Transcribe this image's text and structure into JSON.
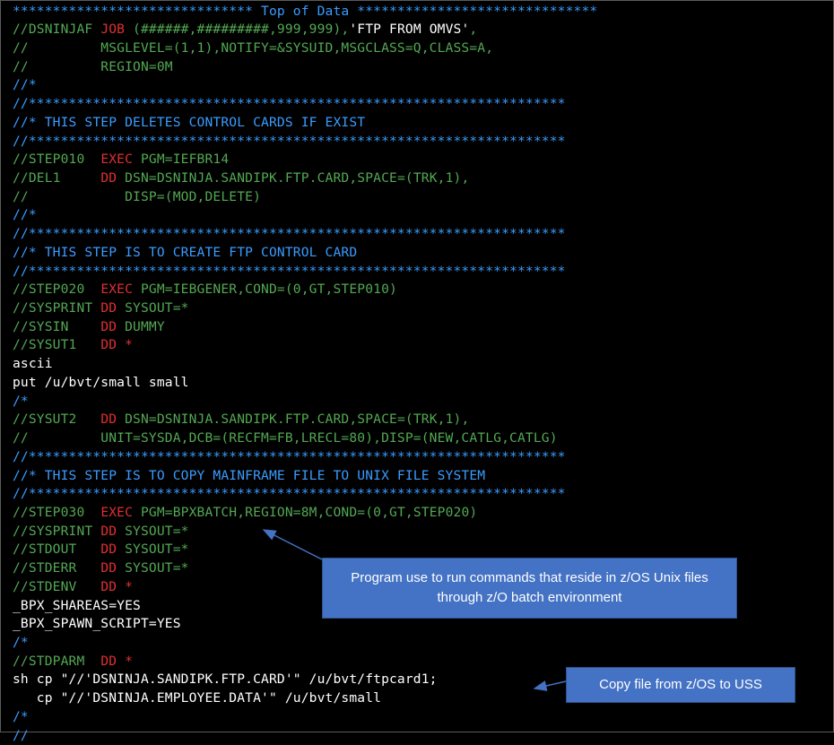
{
  "colors": {
    "background": "#000000",
    "green": "#53a853",
    "red": "#e03030",
    "white": "#ffffff",
    "blue": "#3a9cff",
    "callout_fill": "#4472c4",
    "arrow": "#4472c4"
  },
  "lines": [
    [
      {
        "t": "****************************** Top of Data ******************************",
        "c": "blue"
      }
    ],
    [
      {
        "t": "//DSNINJAF ",
        "c": "green"
      },
      {
        "t": "JOB",
        "c": "red"
      },
      {
        "t": " (######,#########,999,999),",
        "c": "green"
      },
      {
        "t": "'FTP FROM OMVS'",
        "c": "white"
      },
      {
        "t": ",",
        "c": "green"
      }
    ],
    [
      {
        "t": "//         MSGLEVEL=(1,1),NOTIFY=&SYSUID,MSGCLASS=Q,CLASS=A,",
        "c": "green"
      }
    ],
    [
      {
        "t": "//         REGION=0M",
        "c": "green"
      }
    ],
    [
      {
        "t": "//*",
        "c": "blue"
      }
    ],
    [
      {
        "t": "//*******************************************************************",
        "c": "blue"
      }
    ],
    [
      {
        "t": "//* THIS STEP DELETES CONTROL CARDS IF EXIST",
        "c": "blue"
      }
    ],
    [
      {
        "t": "//*******************************************************************",
        "c": "blue"
      }
    ],
    [
      {
        "t": "//STEP010  ",
        "c": "green"
      },
      {
        "t": "EXEC",
        "c": "red"
      },
      {
        "t": " PGM=IEFBR14",
        "c": "green"
      }
    ],
    [
      {
        "t": "//DEL1     ",
        "c": "green"
      },
      {
        "t": "DD",
        "c": "red"
      },
      {
        "t": " DSN=DSNINJA.SANDIPK.FTP.CARD,SPACE=(TRK,1),",
        "c": "green"
      }
    ],
    [
      {
        "t": "//            DISP=(MOD,DELETE)",
        "c": "green"
      }
    ],
    [
      {
        "t": "//*",
        "c": "blue"
      }
    ],
    [
      {
        "t": "//*******************************************************************",
        "c": "blue"
      }
    ],
    [
      {
        "t": "//* THIS STEP IS TO CREATE FTP CONTROL CARD",
        "c": "blue"
      }
    ],
    [
      {
        "t": "//*******************************************************************",
        "c": "blue"
      }
    ],
    [
      {
        "t": "//STEP020  ",
        "c": "green"
      },
      {
        "t": "EXEC",
        "c": "red"
      },
      {
        "t": " PGM=IEBGENER,COND=(0,GT,STEP010)",
        "c": "green"
      }
    ],
    [
      {
        "t": "//SYSPRINT ",
        "c": "green"
      },
      {
        "t": "DD",
        "c": "red"
      },
      {
        "t": " SYSOUT=*",
        "c": "green"
      }
    ],
    [
      {
        "t": "//SYSIN    ",
        "c": "green"
      },
      {
        "t": "DD",
        "c": "red"
      },
      {
        "t": " DUMMY",
        "c": "green"
      }
    ],
    [
      {
        "t": "//SYSUT1   ",
        "c": "green"
      },
      {
        "t": "DD *",
        "c": "red"
      }
    ],
    [
      {
        "t": "ascii",
        "c": "white"
      }
    ],
    [
      {
        "t": "put /u/bvt/small small",
        "c": "white"
      }
    ],
    [
      {
        "t": "/*",
        "c": "blue"
      }
    ],
    [
      {
        "t": "//SYSUT2   ",
        "c": "green"
      },
      {
        "t": "DD",
        "c": "red"
      },
      {
        "t": " DSN=DSNINJA.SANDIPK.FTP.CARD,SPACE=(TRK,1),",
        "c": "green"
      }
    ],
    [
      {
        "t": "//         UNIT=SYSDA,DCB=(RECFM=FB,LRECL=80),DISP=(NEW,CATLG,CATLG)",
        "c": "green"
      }
    ],
    [
      {
        "t": "//*******************************************************************",
        "c": "blue"
      }
    ],
    [
      {
        "t": "//* THIS STEP IS TO COPY MAINFRAME FILE TO UNIX FILE SYSTEM",
        "c": "blue"
      }
    ],
    [
      {
        "t": "//*******************************************************************",
        "c": "blue"
      }
    ],
    [
      {
        "t": "//STEP030  ",
        "c": "green"
      },
      {
        "t": "EXEC",
        "c": "red"
      },
      {
        "t": " PGM=BPXBATCH,REGION=8M,COND=(0,GT,STEP020)",
        "c": "green"
      }
    ],
    [
      {
        "t": "//SYSPRINT ",
        "c": "green"
      },
      {
        "t": "DD",
        "c": "red"
      },
      {
        "t": " SYSOUT=*",
        "c": "green"
      }
    ],
    [
      {
        "t": "//STDOUT   ",
        "c": "green"
      },
      {
        "t": "DD",
        "c": "red"
      },
      {
        "t": " SYSOUT=*",
        "c": "green"
      }
    ],
    [
      {
        "t": "//STDERR   ",
        "c": "green"
      },
      {
        "t": "DD",
        "c": "red"
      },
      {
        "t": " SYSOUT=*",
        "c": "green"
      }
    ],
    [
      {
        "t": "//STDENV   ",
        "c": "green"
      },
      {
        "t": "DD *",
        "c": "red"
      }
    ],
    [
      {
        "t": "_BPX_SHAREAS=YES",
        "c": "white"
      }
    ],
    [
      {
        "t": "_BPX_SPAWN_SCRIPT=YES",
        "c": "white"
      }
    ],
    [
      {
        "t": "/*",
        "c": "blue"
      }
    ],
    [
      {
        "t": "//STDPARM  ",
        "c": "green"
      },
      {
        "t": "DD *",
        "c": "red"
      }
    ],
    [
      {
        "t": "sh cp \"//'DSNINJA.SANDIPK.FTP.CARD'\" /u/bvt/ftpcard1;",
        "c": "white"
      }
    ],
    [
      {
        "t": "   cp \"//'DSNINJA.EMPLOYEE.DATA'\" /u/bvt/small",
        "c": "white"
      }
    ],
    [
      {
        "t": "/*",
        "c": "blue"
      }
    ],
    [
      {
        "t": "//",
        "c": "blue"
      }
    ]
  ],
  "callouts": {
    "bpxbatch": "Program use to run commands that reside in z/OS Unix files through z/O batch environment",
    "copy": "Copy file from z/OS to USS"
  }
}
